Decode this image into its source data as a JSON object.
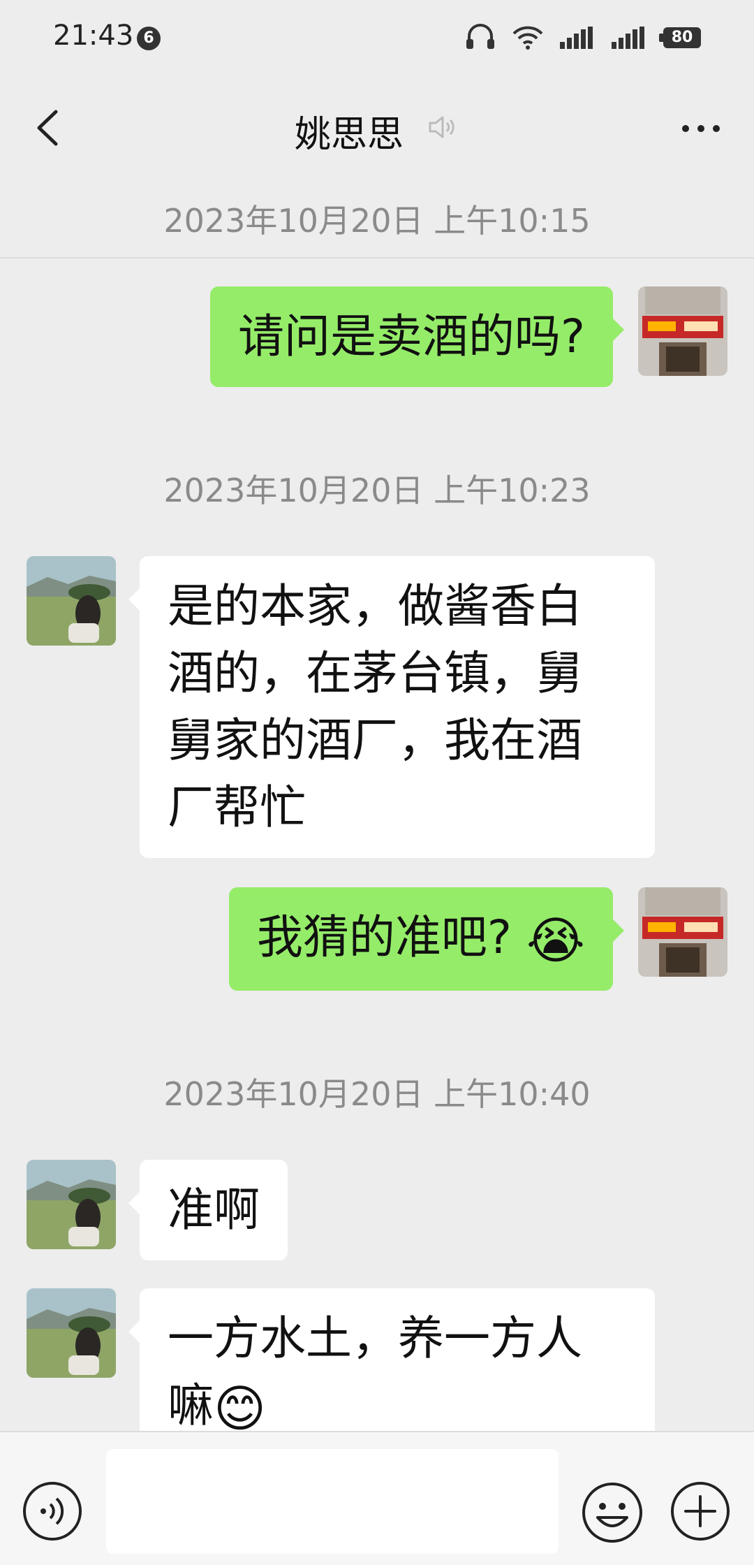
{
  "status_bar": {
    "time": "21:43",
    "notification_count": "6",
    "battery": "80",
    "icons": [
      "headset-icon",
      "wifi-icon",
      "signal-icon",
      "signal-2-icon",
      "battery-icon"
    ]
  },
  "header": {
    "title": "姚思思",
    "back_icon": "chevron-left-icon",
    "mute_icon": "mute-icon",
    "more_icon": "more-icon"
  },
  "messages": [
    {
      "type": "timestamp",
      "text": "2023年10月20日 上午10:15"
    },
    {
      "type": "out",
      "text": "请问是卖酒的吗?"
    },
    {
      "type": "timestamp",
      "text": "2023年10月20日 上午10:23"
    },
    {
      "type": "in",
      "text": "是的本家，做酱香白酒的，在茅台镇，舅舅家的酒厂，我在酒厂帮忙"
    },
    {
      "type": "out",
      "text": "我猜的准吧?",
      "emoji": "😭"
    },
    {
      "type": "timestamp",
      "text": "2023年10月20日 上午10:40"
    },
    {
      "type": "in",
      "text": "准啊"
    },
    {
      "type": "in",
      "text": "一方水土，养一方人嘛",
      "emoji": "😊"
    }
  ],
  "input_bar": {
    "placeholder": "",
    "voice_icon": "voice-icon",
    "emoji_icon": "emoji-icon",
    "plus_icon": "plus-icon"
  },
  "colors": {
    "background": "#ededed",
    "outgoing_bubble": "#95ec69",
    "incoming_bubble": "#ffffff",
    "timestamp_text": "#8a8a8a"
  }
}
